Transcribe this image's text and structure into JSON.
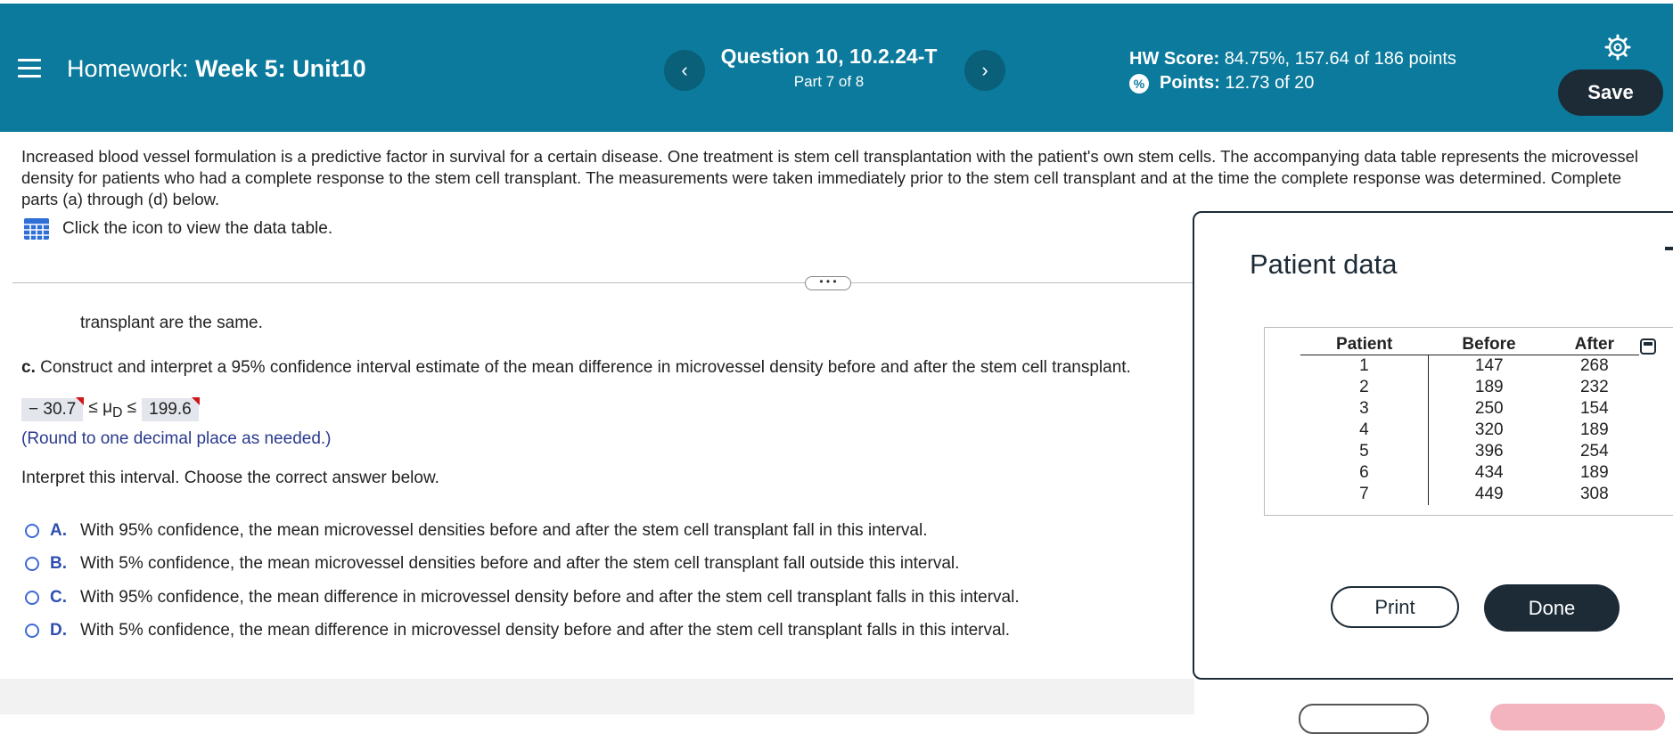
{
  "header": {
    "homework_label": "Homework:",
    "homework_name": "Week 5: Unit10",
    "prev_label": "‹",
    "next_label": "›",
    "question_title": "Question 10, 10.2.24-T",
    "question_part": "Part 7 of 8",
    "hw_score_label": "HW Score:",
    "hw_score_value": "84.75%, 157.64 of 186 points",
    "points_label": "Points:",
    "points_value": "12.73 of 20",
    "save_label": "Save"
  },
  "question": {
    "intro": "Increased blood vessel formulation is a predictive factor in survival for a certain disease. One treatment is stem cell transplantation with the patient's own stem cells. The accompanying data table represents the microvessel density for patients who had a complete response to the stem cell transplant. The measurements were taken immediately prior to the stem cell transplant and at the time the complete response was determined. Complete parts (a) through (d) below.",
    "data_link": "Click the icon to view the data table.",
    "dots": "• • •",
    "transplant_tail": "transplant are the same.",
    "part_c_letter": "c.",
    "part_c_text": "Construct and interpret a 95% confidence interval estimate of the mean difference in microvessel density before and after the stem cell transplant.",
    "ci_lower": "− 30.7",
    "ci_middle": "≤ μ",
    "ci_sub": "D",
    "ci_le": "≤",
    "ci_upper": "199.6",
    "round_note": "(Round to one decimal place as needed.)",
    "interpret": "Interpret this interval. Choose the correct answer below.",
    "options": [
      {
        "letter": "A.",
        "text": "With 95% confidence, the mean microvessel densities before and after the stem cell transplant fall in this interval."
      },
      {
        "letter": "B.",
        "text": "With 5% confidence, the mean microvessel densities before and after the stem cell transplant fall outside this interval."
      },
      {
        "letter": "C.",
        "text": "With 95% confidence, the mean difference in microvessel density before and after the stem cell transplant falls in this interval."
      },
      {
        "letter": "D.",
        "text": "With 5% confidence, the mean difference in microvessel density before and after the stem cell transplant falls in this interval."
      }
    ]
  },
  "modal": {
    "title": "Patient data",
    "columns": [
      "Patient",
      "Before",
      "After"
    ],
    "rows": [
      [
        "1",
        "147",
        "268"
      ],
      [
        "2",
        "189",
        "232"
      ],
      [
        "3",
        "250",
        "154"
      ],
      [
        "4",
        "320",
        "189"
      ],
      [
        "5",
        "396",
        "254"
      ],
      [
        "6",
        "434",
        "189"
      ],
      [
        "7",
        "449",
        "308"
      ]
    ],
    "print_label": "Print",
    "done_label": "Done"
  }
}
